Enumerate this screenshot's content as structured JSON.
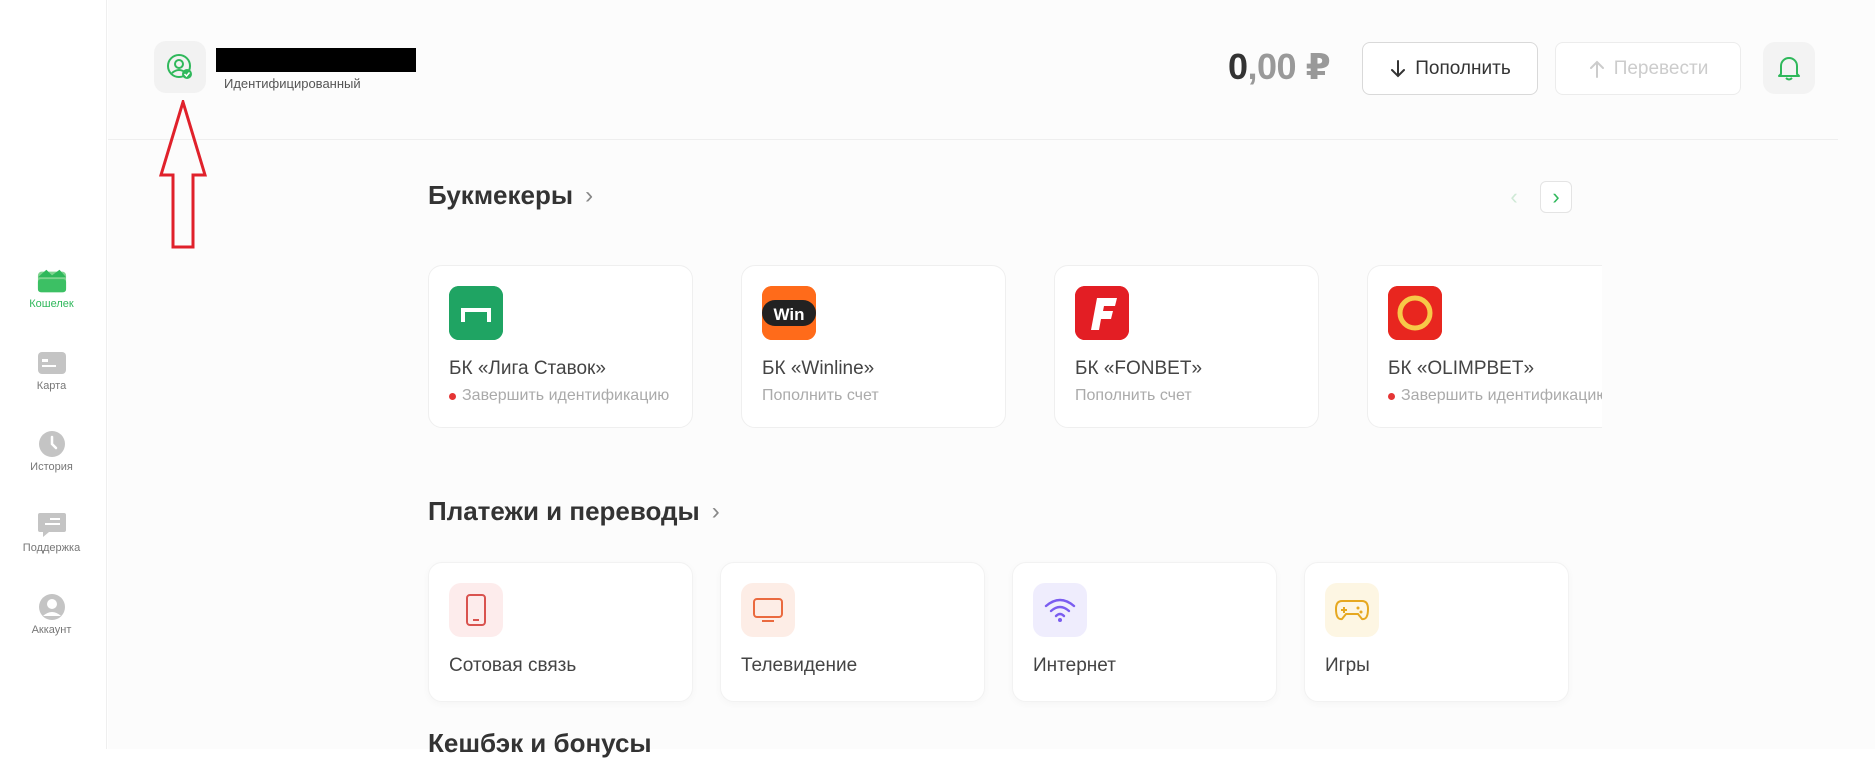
{
  "sidebar": {
    "items": [
      {
        "label": "Кошелек",
        "icon": "wallet-icon",
        "active": true
      },
      {
        "label": "Карта",
        "icon": "card-icon",
        "active": false
      },
      {
        "label": "История",
        "icon": "clock-icon",
        "active": false
      },
      {
        "label": "Поддержка",
        "icon": "chat-icon",
        "active": false
      },
      {
        "label": "Аккаунт",
        "icon": "user-icon",
        "active": false
      }
    ]
  },
  "header": {
    "profile_status": "Идентифицированный",
    "balance_int": "0",
    "balance_dec": ",00",
    "currency": "₽",
    "topup_label": "Пополнить",
    "transfer_label": "Перевести"
  },
  "bookmakers": {
    "title": "Букмекеры",
    "items": [
      {
        "name": "БК «Лига Ставок»",
        "status": "Завершить идентификацию",
        "warning": true,
        "color": "#1fa463"
      },
      {
        "name": "БК «Winline»",
        "status": "Пополнить счет",
        "warning": false,
        "color": "#ff6b1a"
      },
      {
        "name": "БК «FONBET»",
        "status": "Пополнить счет",
        "warning": false,
        "color": "#e31e24"
      },
      {
        "name": "БК «OLIMPBET»",
        "status": "Завершить идентификацию",
        "warning": true,
        "color": "#e8261f"
      }
    ]
  },
  "payments": {
    "title": "Платежи и переводы",
    "items": [
      {
        "label": "Сотовая связь",
        "icon": "phone-icon"
      },
      {
        "label": "Телевидение",
        "icon": "tv-icon"
      },
      {
        "label": "Интернет",
        "icon": "wifi-icon"
      },
      {
        "label": "Игры",
        "icon": "gamepad-icon"
      }
    ]
  },
  "cashback": {
    "title": "Кешбэк и бонусы"
  },
  "colors": {
    "accent": "#2fb85b"
  }
}
